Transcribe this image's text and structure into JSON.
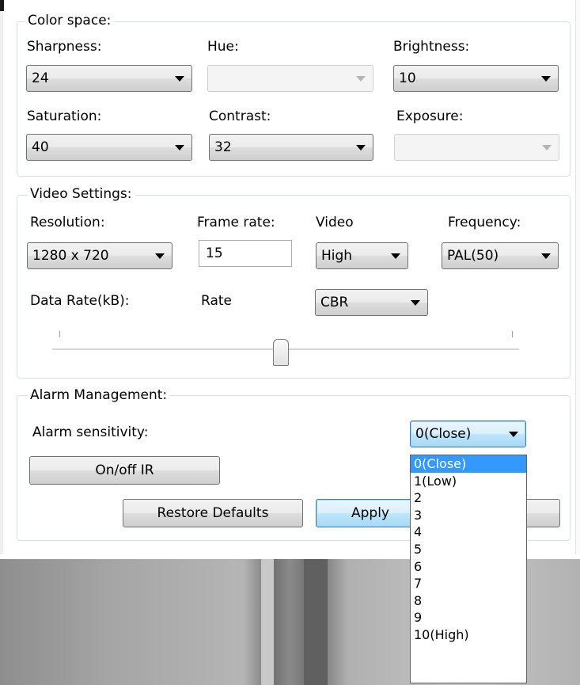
{
  "color_space": {
    "legend": "Color space:",
    "sharpness": {
      "label": "Sharpness:",
      "value": "24"
    },
    "hue": {
      "label": "Hue:",
      "value": ""
    },
    "brightness": {
      "label": "Brightness:",
      "value": "10"
    },
    "saturation": {
      "label": "Saturation:",
      "value": "40"
    },
    "contrast": {
      "label": "Contrast:",
      "value": "32"
    },
    "exposure": {
      "label": "Exposure:",
      "value": ""
    }
  },
  "video_settings": {
    "legend": "Video Settings:",
    "resolution": {
      "label": "Resolution:",
      "value": "1280 x 720"
    },
    "frame_rate": {
      "label": "Frame rate:",
      "value": "15"
    },
    "video": {
      "label": "Video",
      "value": "High"
    },
    "frequency": {
      "label": "Frequency:",
      "value": "PAL(50)"
    },
    "data_rate_label": "Data Rate(kB):",
    "rate": {
      "label": "Rate",
      "value": "CBR"
    },
    "data_rate_slider": {
      "level": 0.5
    }
  },
  "alarm_management": {
    "legend": "Alarm Management:",
    "sensitivity": {
      "label": "Alarm sensitivity:",
      "value": "0(Close)",
      "options": [
        "0(Close)",
        "1(Low)",
        "2",
        "3",
        "4",
        "5",
        "6",
        "7",
        "8",
        "9",
        "10(High)"
      ],
      "selected_index": 0
    },
    "ir_button": "On/off IR"
  },
  "actions": {
    "restore_defaults": "Restore Defaults",
    "apply": "Apply"
  },
  "colors": {
    "group_border": "#d5dfe5",
    "focus_border": "#3c7fb1",
    "selection": "#3399ff"
  }
}
